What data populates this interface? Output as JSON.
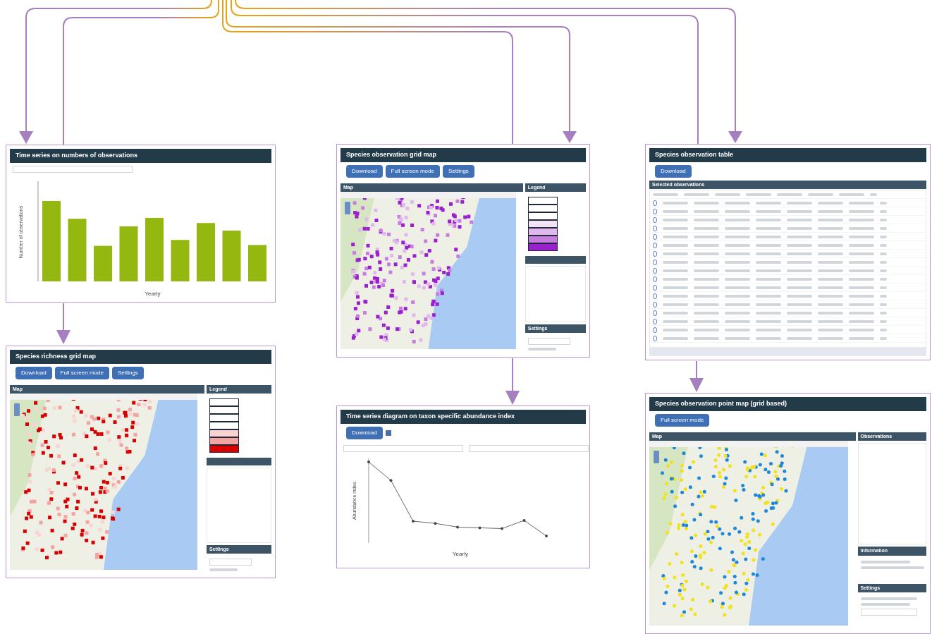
{
  "panels": [
    {
      "kind": "bar_chart",
      "title": "Time series on numbers of observations",
      "xlabel": "Yearly",
      "ylabel": "Number of observations"
    },
    {
      "kind": "grid_map",
      "title": "Species richness grid map",
      "buttons": [
        "Download",
        "Full screen mode",
        "Settings"
      ],
      "map_header": "Map",
      "legend_header": "Legend",
      "settings_header": "Settings",
      "legend": [
        {
          "color": "#ffffff"
        },
        {
          "color": "#ffffff"
        },
        {
          "color": "#ffffff"
        },
        {
          "color": "#ffffff"
        },
        {
          "color": "#fbd3d3"
        },
        {
          "color": "#f4a3a3"
        },
        {
          "color": "#d90000"
        }
      ]
    },
    {
      "kind": "grid_map",
      "title": "Species observation grid map",
      "buttons": [
        "Download",
        "Full screen mode",
        "Settings"
      ],
      "map_header": "Map",
      "legend_header": "Legend",
      "settings_header": "Settings",
      "legend": [
        {
          "color": "#ffffff"
        },
        {
          "color": "#ffffff"
        },
        {
          "color": "#ffffff"
        },
        {
          "color": "#f3e2f7"
        },
        {
          "color": "#e1b8ee"
        },
        {
          "color": "#c77ddf"
        },
        {
          "color": "#9b1fcf"
        }
      ]
    },
    {
      "kind": "line_chart",
      "title": "Time series diagram on taxon specific abundance index",
      "buttons": [
        "Download"
      ],
      "checkbox": {
        "checked": true
      },
      "xlabel": "Yearly",
      "ylabel": "Abundance index"
    },
    {
      "kind": "table",
      "title": "Species observation table",
      "buttons": [
        "Download"
      ],
      "table_header": "Selected observations"
    },
    {
      "kind": "point_map",
      "title": "Species observation point map (grid based)",
      "buttons": [
        "Full screen mode"
      ],
      "map_header": "Map",
      "side_headers": [
        "Observations",
        "Information",
        "Settings"
      ]
    }
  ]
}
